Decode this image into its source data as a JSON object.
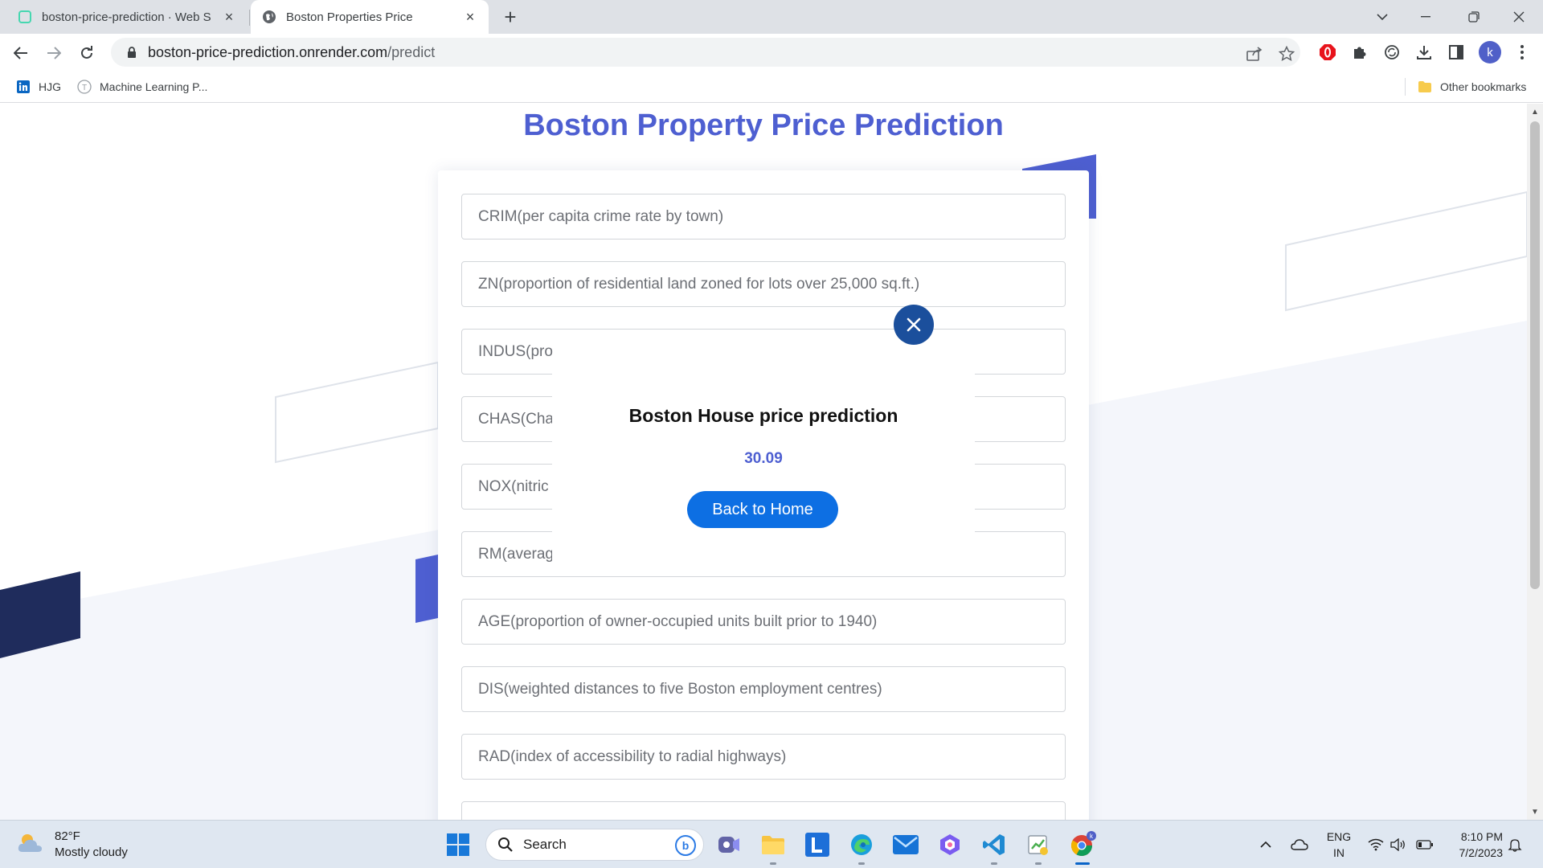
{
  "browser": {
    "tabs": [
      {
        "title": "boston-price-prediction · Web S",
        "favicon": "render-icon",
        "active": false
      },
      {
        "title": "Boston Properties Price",
        "favicon": "globe-icon",
        "active": true
      }
    ],
    "url_host": "boston-price-prediction.onrender.com",
    "url_path": "/predict",
    "profile_initial": "k"
  },
  "bookmarks": {
    "items": [
      {
        "label": "HJG",
        "icon": "linkedin-icon"
      },
      {
        "label": "Machine Learning P...",
        "icon": "site-icon"
      }
    ],
    "other": "Other bookmarks"
  },
  "page": {
    "title": "Boston Property Price Prediction",
    "fields": [
      "CRIM(per capita crime rate by town)",
      "ZN(proportion of residential land zoned for lots over 25,000 sq.ft.)",
      "INDUS(pro",
      "CHAS(Char",
      "NOX(nitric",
      "RM(averag",
      "AGE(proportion of owner-occupied units built prior to 1940)",
      "DIS(weighted distances to five Boston employment centres)",
      "RAD(index of accessibility to radial highways)"
    ],
    "colors": {
      "accent": "#4e5fd1",
      "navy": "#1f2c5c",
      "button": "#0d6fe3"
    }
  },
  "modal": {
    "heading": "Boston House price prediction",
    "value": "30.09",
    "button": "Back to Home"
  },
  "taskbar": {
    "weather_temp": "82°F",
    "weather_desc": "Mostly cloudy",
    "search": "Search",
    "lang_top": "ENG",
    "lang_bottom": "IN",
    "time": "8:10 PM",
    "date": "7/2/2023"
  }
}
